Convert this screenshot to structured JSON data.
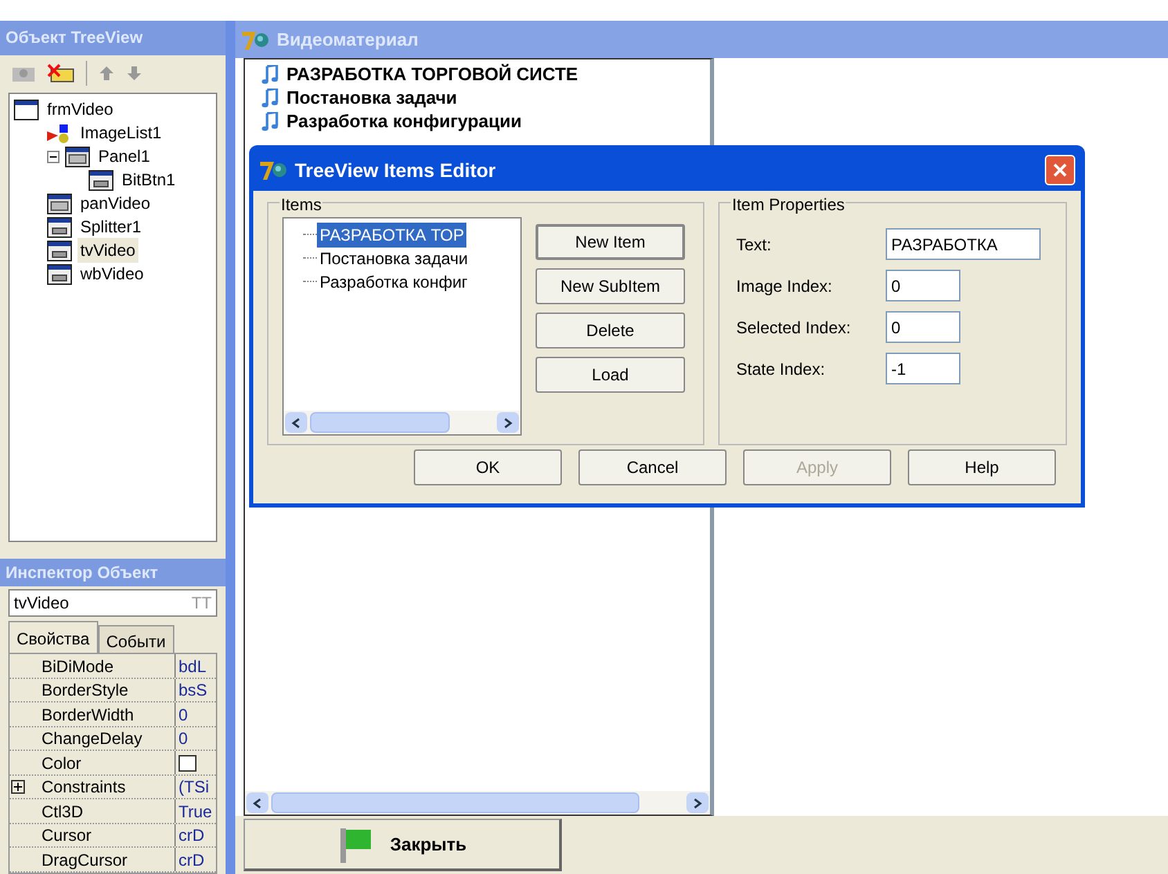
{
  "object_treeview": {
    "title": "Объект TreeView",
    "items": [
      {
        "label": "frmVideo",
        "kind": "form",
        "selected": false,
        "children": [
          {
            "label": "ImageList1",
            "kind": "imagelist",
            "selected": false
          },
          {
            "label": "Panel1",
            "kind": "panel",
            "selected": false,
            "expanded": true,
            "children": [
              {
                "label": "BitBtn1",
                "kind": "control",
                "selected": false
              }
            ]
          },
          {
            "label": "panVideo",
            "kind": "panel",
            "selected": false
          },
          {
            "label": "Splitter1",
            "kind": "control",
            "selected": false
          },
          {
            "label": "tvVideo",
            "kind": "control",
            "selected": true
          },
          {
            "label": "wbVideo",
            "kind": "control",
            "selected": false
          }
        ]
      }
    ]
  },
  "object_inspector": {
    "title": "Инспектор Объект",
    "component": "tvVideo",
    "component_type": "TT",
    "tabs": [
      {
        "label": "Свойства",
        "selected": true
      },
      {
        "label": "Событи",
        "selected": false
      }
    ],
    "properties": [
      {
        "name": "BiDiMode",
        "value": "bdL",
        "kind": "text"
      },
      {
        "name": "BorderStyle",
        "value": "bsS",
        "kind": "text"
      },
      {
        "name": "BorderWidth",
        "value": "0",
        "kind": "text"
      },
      {
        "name": "ChangeDelay",
        "value": "0",
        "kind": "text"
      },
      {
        "name": "Color",
        "kind": "color"
      },
      {
        "name": "Constraints",
        "value": "(TSi",
        "kind": "set"
      },
      {
        "name": "Ctl3D",
        "value": "True",
        "kind": "text"
      },
      {
        "name": "Cursor",
        "value": "crD",
        "kind": "text"
      },
      {
        "name": "DragCursor",
        "value": "crD",
        "kind": "text"
      }
    ]
  },
  "form": {
    "title": "Видеоматериал",
    "tree_items": [
      "РАЗРАБОТКА ТОРГОВОЙ СИСТЕ",
      "Постановка задачи",
      "Разработка конфигурации"
    ],
    "close_button": "Закрыть"
  },
  "dialog": {
    "title": "TreeView Items Editor",
    "items_group": "Items",
    "items": [
      {
        "label": "РАЗРАБОТКА ТОР",
        "selected": true
      },
      {
        "label": "Постановка задачи",
        "selected": false
      },
      {
        "label": "Разработка конфиг",
        "selected": false
      }
    ],
    "item_buttons": [
      "New Item",
      "New SubItem",
      "Delete",
      "Load"
    ],
    "properties_group": "Item Properties",
    "fields": [
      {
        "label": "Text:",
        "value": "РАЗРАБОТКА"
      },
      {
        "label": "Image Index:",
        "value": "0"
      },
      {
        "label": "Selected Index:",
        "value": "0"
      },
      {
        "label": "State Index:",
        "value": "-1"
      }
    ],
    "buttons": [
      {
        "label": "OK",
        "disabled": false
      },
      {
        "label": "Cancel",
        "disabled": false
      },
      {
        "label": "Apply",
        "disabled": true
      },
      {
        "label": "Help",
        "disabled": false
      }
    ]
  }
}
